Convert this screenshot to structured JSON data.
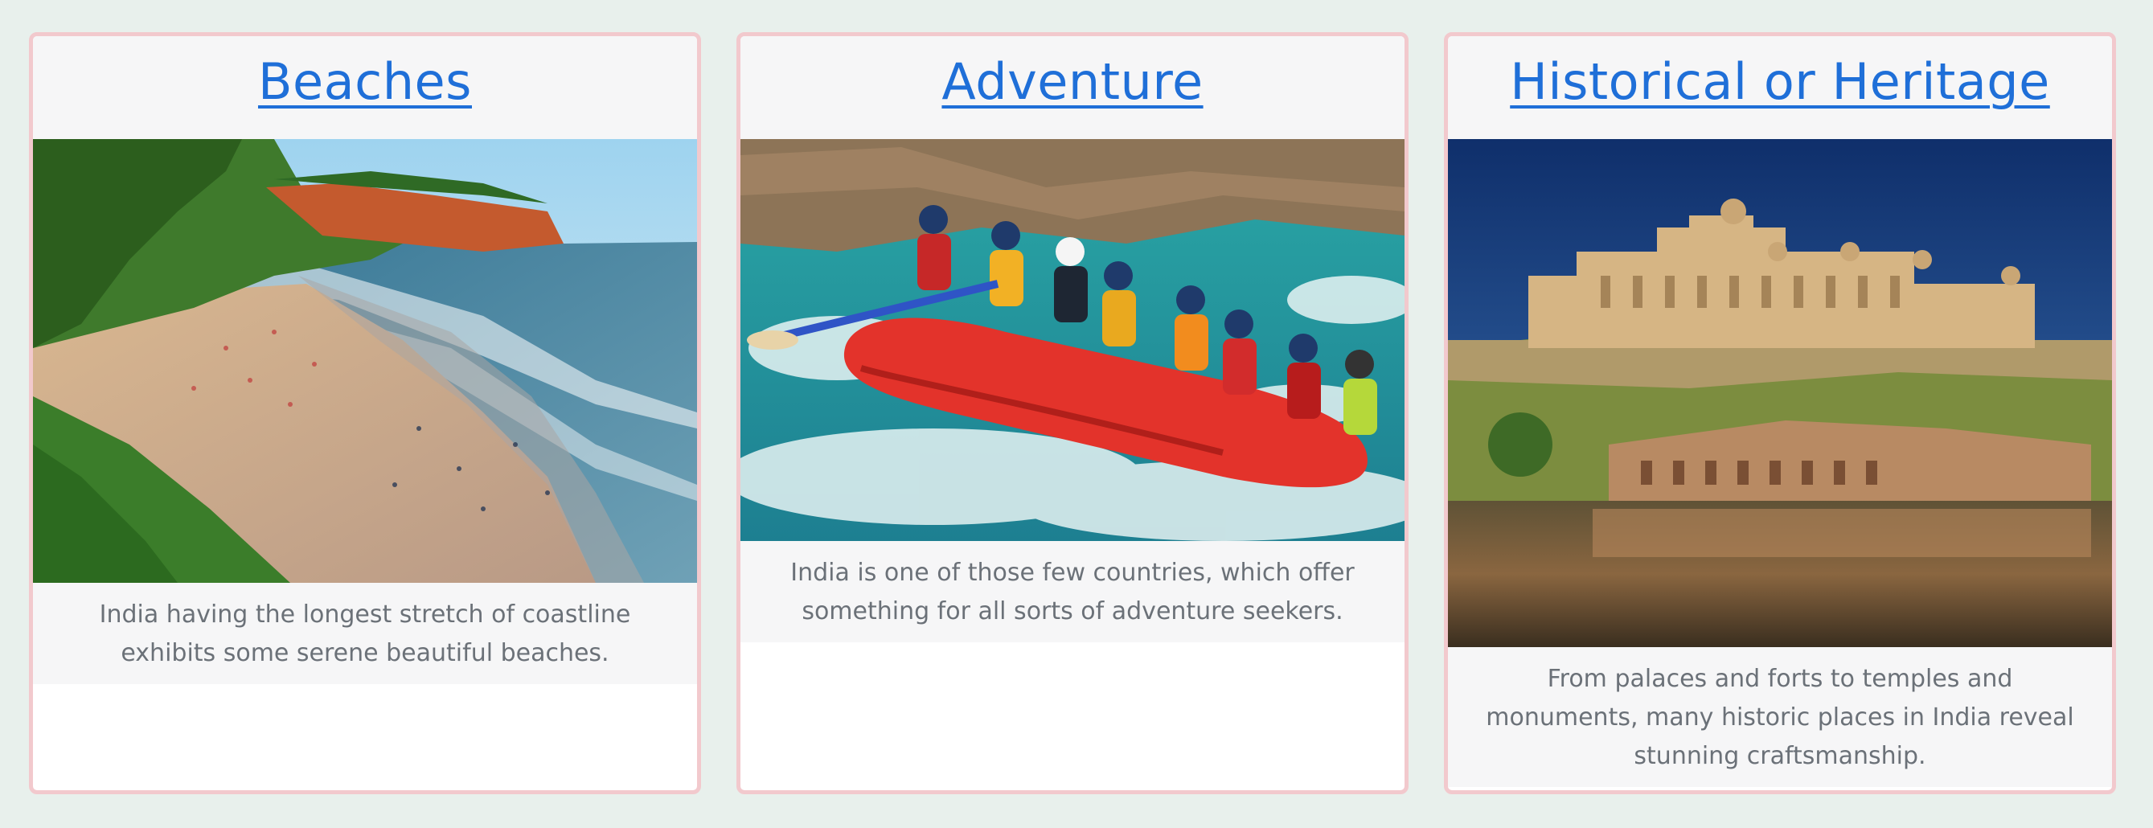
{
  "cards": [
    {
      "title": "Beaches",
      "description": "India having the longest stretch of coastline exhibits some serene beautiful beaches."
    },
    {
      "title": "Adventure",
      "description": "India is one of those few countries, which offer something for all sorts of adventure seekers."
    },
    {
      "title": "Historical or Heritage",
      "description": "From palaces and forts to temples and monuments, many historic places in India reveal stunning craftsmanship."
    }
  ],
  "colors": {
    "page_background": "#e8f0ec",
    "card_border": "#f2c9cd",
    "link": "#1f6fd8",
    "card_section_bg": "#f6f6f7",
    "description_text": "#6b7178"
  }
}
